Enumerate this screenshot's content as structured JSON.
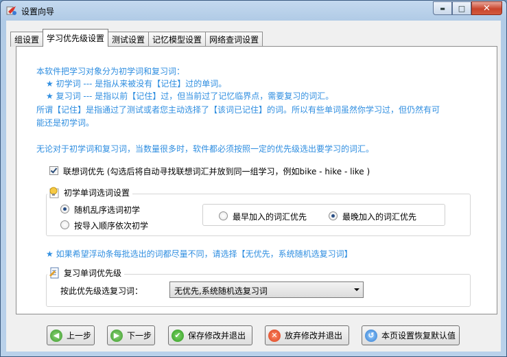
{
  "window": {
    "title": "设置向导",
    "min": "▬",
    "max": "□",
    "close": "✕"
  },
  "tabs": [
    {
      "label": "组设置"
    },
    {
      "label": "学习优先级设置"
    },
    {
      "label": "测试设置"
    },
    {
      "label": "记忆模型设置"
    },
    {
      "label": "网络查词设置"
    }
  ],
  "intro": {
    "line1": "本软件把学习对象分为初学词和复习词：",
    "line2": "★ 初学词 --- 是指从来被没有【记住】过的单词。",
    "line3": "★ 复习词 --- 是指以前【记住】过，但当前过了记忆临界点，需要复习的词汇。",
    "line4": "所谓【记住】是指通过了测试或者您主动选择了【该词已记住】的词。所以有些单词虽然你学习过，但仍然有可",
    "line5": "能还是初学词。",
    "line6": "无论对于初学词和复习词，当数量很多时，软件都必须按照一定的优先级选出要学习的词汇。"
  },
  "assoc_checkbox": {
    "label": "联想词优先 (勾选后将自动寻找联想词汇并放到同一组学习，例如bike - hike - like )",
    "checked": true
  },
  "new_word_group": {
    "title": "初学单词选词设置",
    "options": [
      {
        "label": "随机乱序选词初学",
        "selected": true
      },
      {
        "label": "按导入顺序依次初学",
        "selected": false
      }
    ],
    "priority_options": [
      {
        "label": "最早加入的词汇优先",
        "selected": false
      },
      {
        "label": "最晚加入的词汇优先",
        "selected": true
      }
    ]
  },
  "hint": "★ 如果希望浮动条每批选出的词都尽量不同，请选择【无优先，系统随机选复习词】",
  "review_group": {
    "title": "复习单词优先级",
    "label": "按此优先级选复习词：",
    "selected": "无优先,系统随机选复习词"
  },
  "buttons": {
    "prev": "上一步",
    "next": "下一步",
    "save": "保存修改并退出",
    "discard": "放弃修改并退出",
    "reset": "本页设置恢复默认值"
  },
  "colors": {
    "accent_text": "#2f8ee0",
    "title_bar": "#b9d1ea"
  }
}
